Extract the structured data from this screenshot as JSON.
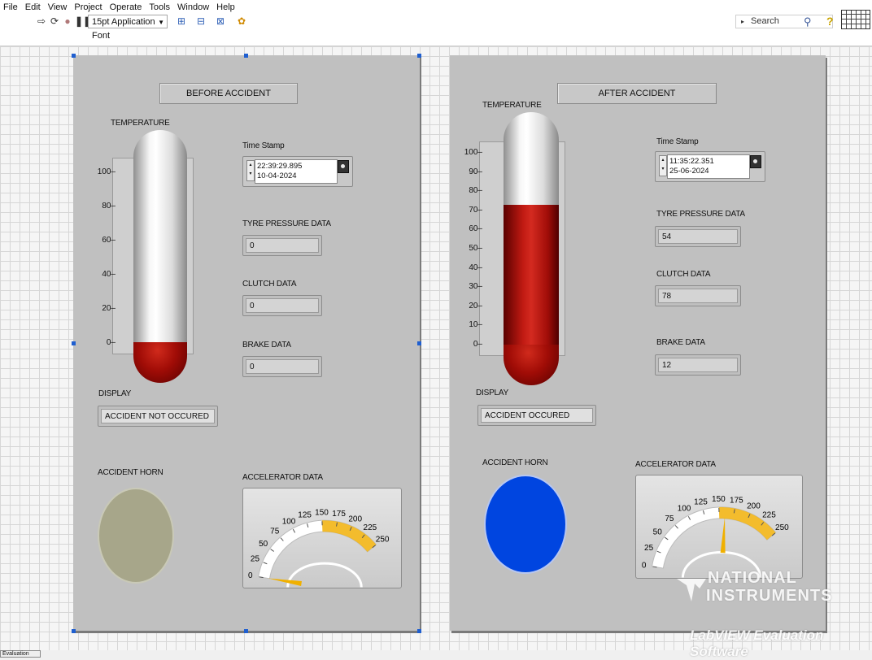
{
  "menu": [
    "File",
    "Edit",
    "View",
    "Project",
    "Operate",
    "Tools",
    "Window",
    "Help"
  ],
  "toolbar": {
    "font_select": "15pt Application Font",
    "search_placeholder": "Search"
  },
  "icons": {
    "run": "run-arrow-icon",
    "run_continuous": "run-continuously-icon",
    "abort": "abort-icon",
    "pause": "pause-icon",
    "align": "align-objects-icon",
    "distribute": "distribute-objects-icon",
    "resize": "resize-objects-icon",
    "reorder": "reorder-icon",
    "search": "magnifier-icon",
    "help": "help-icon",
    "connector": "connector-pane-icon"
  },
  "before": {
    "title": "BEFORE ACCIDENT",
    "temperature_label": "TEMPERATURE",
    "temperature_ticks": [
      "100",
      "80",
      "60",
      "40",
      "20",
      "0"
    ],
    "temperature_value": 0,
    "time_stamp_label": "Time Stamp",
    "time": "22:39:29.895",
    "date": "10-04-2024",
    "tyre_label": "TYRE PRESSURE DATA",
    "tyre_value": "0",
    "clutch_label": "CLUTCH DATA",
    "clutch_value": "0",
    "brake_label": "BRAKE DATA",
    "brake_value": "0",
    "display_label": "DISPLAY",
    "display_value": "ACCIDENT NOT OCCURED",
    "horn_label": "ACCIDENT HORN",
    "horn_color": "#a7a68a",
    "accel_label": "ACCELERATOR DATA",
    "accel_value": 0
  },
  "after": {
    "title": "AFTER ACCIDENT",
    "temperature_label": "TEMPERATURE",
    "temperature_ticks": [
      "100",
      "90",
      "80",
      "70",
      "60",
      "50",
      "40",
      "30",
      "20",
      "10",
      "0"
    ],
    "temperature_value": 73,
    "time_stamp_label": "Time Stamp",
    "time": "11:35:22.351",
    "date": "25-06-2024",
    "tyre_label": "TYRE PRESSURE DATA",
    "tyre_value": "54",
    "clutch_label": "CLUTCH DATA",
    "clutch_value": "78",
    "brake_label": "BRAKE DATA",
    "brake_value": "12",
    "display_label": "DISPLAY",
    "display_value": "ACCIDENT OCCURED",
    "horn_label": "ACCIDENT HORN",
    "horn_color": "#0045e0",
    "accel_label": "ACCELERATOR DATA",
    "accel_value": 160
  },
  "gauge_scale": [
    "0",
    "25",
    "50",
    "75",
    "100",
    "125",
    "150",
    "175",
    "200",
    "225",
    "250"
  ],
  "watermark": {
    "line1": "NATIONAL",
    "line2": "INSTRUMENTS",
    "line3": "LabVIEW Evaluation Software"
  },
  "bottom_tab": "Evaluation"
}
